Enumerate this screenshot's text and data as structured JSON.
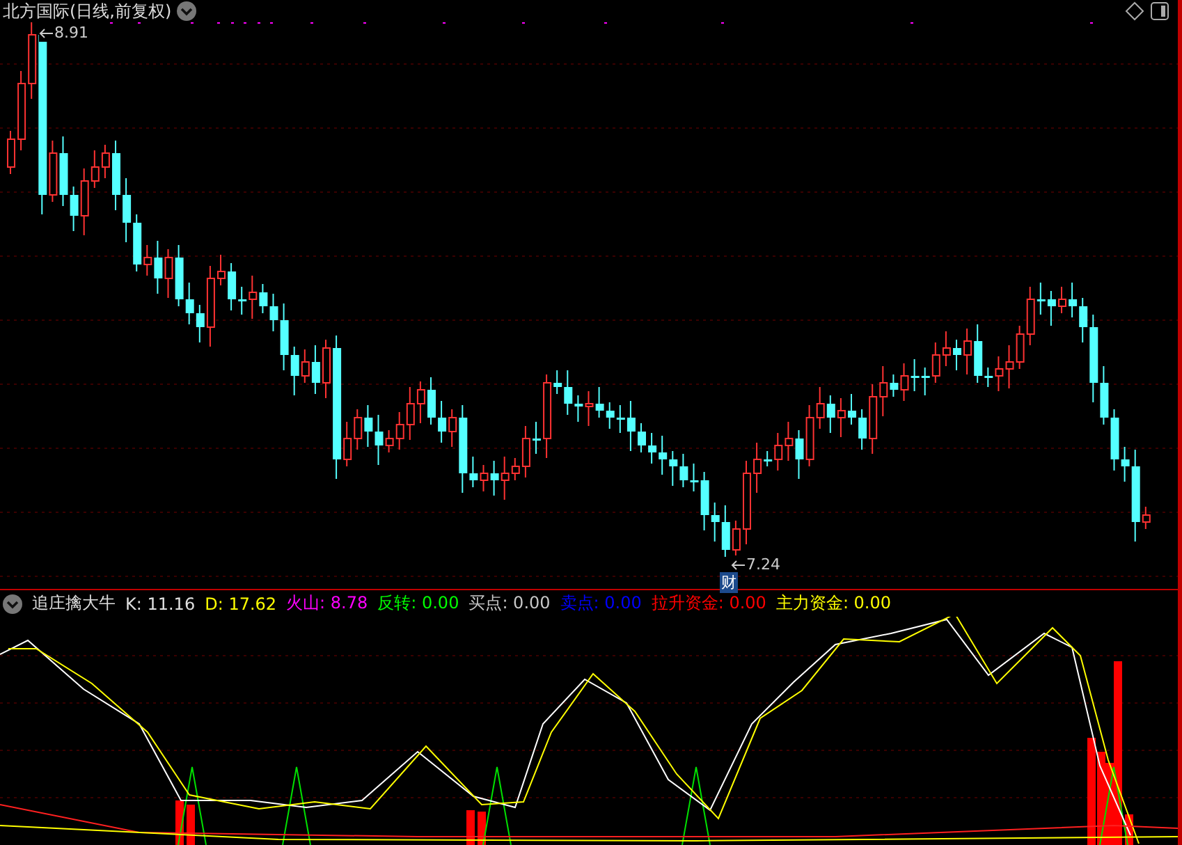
{
  "chart": {
    "title": "北方国际(日线,前复权)",
    "high_label": "8.91",
    "low_label": "7.24",
    "signal_badge": "财"
  },
  "indicator": {
    "name": "追庄擒大牛",
    "values": [
      {
        "label": "K:",
        "value": "11.16",
        "color": "#e0e0e0"
      },
      {
        "label": "D:",
        "value": "17.62",
        "color": "#ffff00"
      },
      {
        "label": "火山:",
        "value": "8.78",
        "color": "#ff00ff"
      },
      {
        "label": "反转:",
        "value": "0.00",
        "color": "#00ff00"
      },
      {
        "label": "买点:",
        "value": "0.00",
        "color": "#c8c8c8"
      },
      {
        "label": "卖点:",
        "value": "0.00",
        "color": "#0000ff"
      },
      {
        "label": "拉升资金:",
        "value": "0.00",
        "color": "#ff0000"
      },
      {
        "label": "主力资金:",
        "value": "0.00",
        "color": "#ffff00"
      }
    ]
  }
}
